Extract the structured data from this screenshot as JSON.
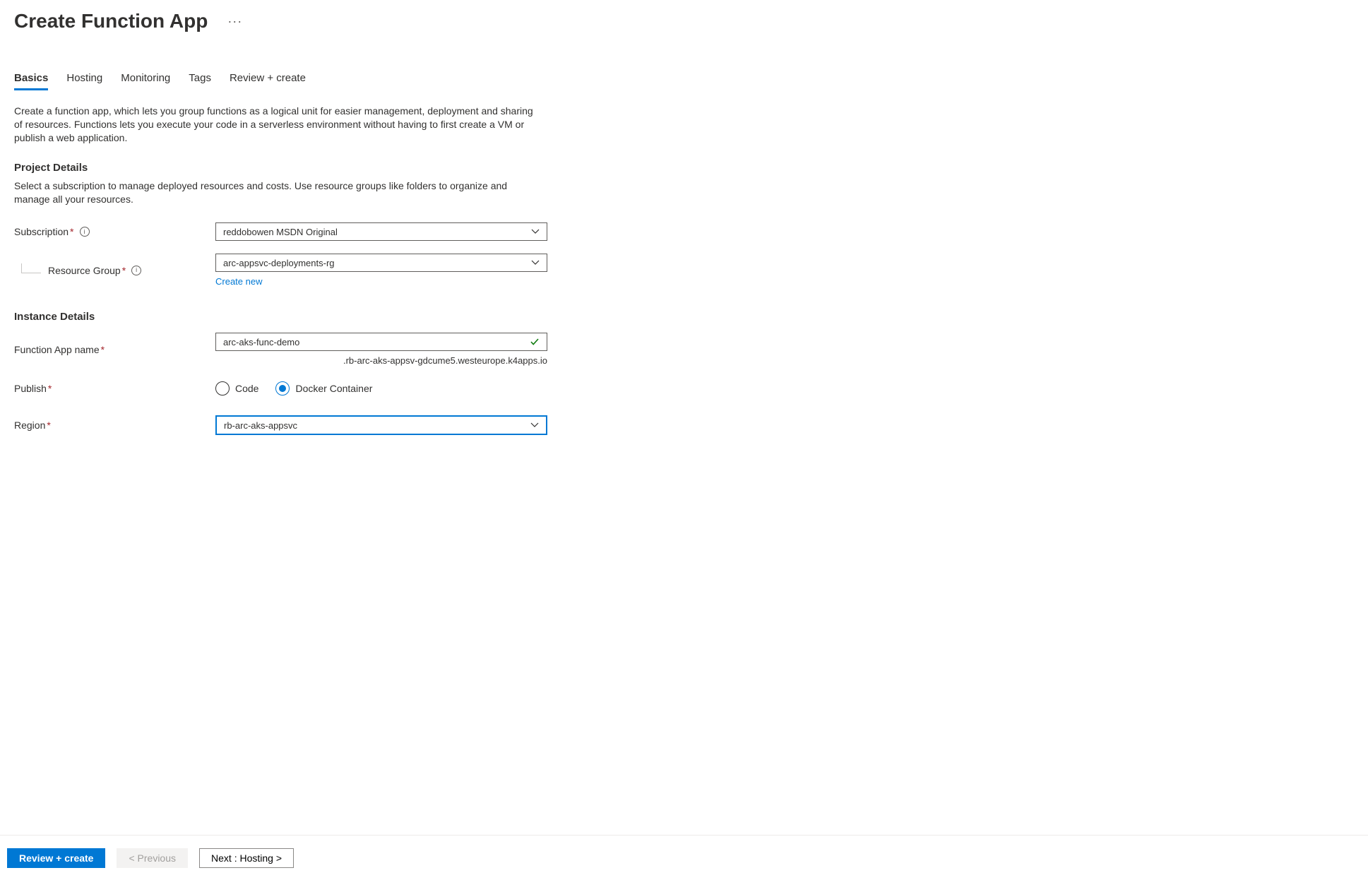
{
  "header": {
    "title": "Create Function App"
  },
  "tabs": {
    "basics": "Basics",
    "hosting": "Hosting",
    "monitoring": "Monitoring",
    "tags": "Tags",
    "review": "Review + create"
  },
  "intro": "Create a function app, which lets you group functions as a logical unit for easier management, deployment and sharing of resources. Functions lets you execute your code in a serverless environment without having to first create a VM or publish a web application.",
  "project": {
    "title": "Project Details",
    "desc": "Select a subscription to manage deployed resources and costs. Use resource groups like folders to organize and manage all your resources.",
    "subscription_label": "Subscription",
    "subscription_value": "reddobowen MSDN Original",
    "rg_label": "Resource Group",
    "rg_value": "arc-appsvc-deployments-rg",
    "create_new": "Create new"
  },
  "instance": {
    "title": "Instance Details",
    "name_label": "Function App name",
    "name_value": "arc-aks-func-demo",
    "name_suffix": ".rb-arc-aks-appsv-gdcume5.westeurope.k4apps.io",
    "publish_label": "Publish",
    "publish_options": {
      "code": "Code",
      "docker": "Docker Container"
    },
    "region_label": "Region",
    "region_value": "rb-arc-aks-appsvc"
  },
  "footer": {
    "review": "Review + create",
    "prev": "< Previous",
    "next": "Next : Hosting >"
  }
}
